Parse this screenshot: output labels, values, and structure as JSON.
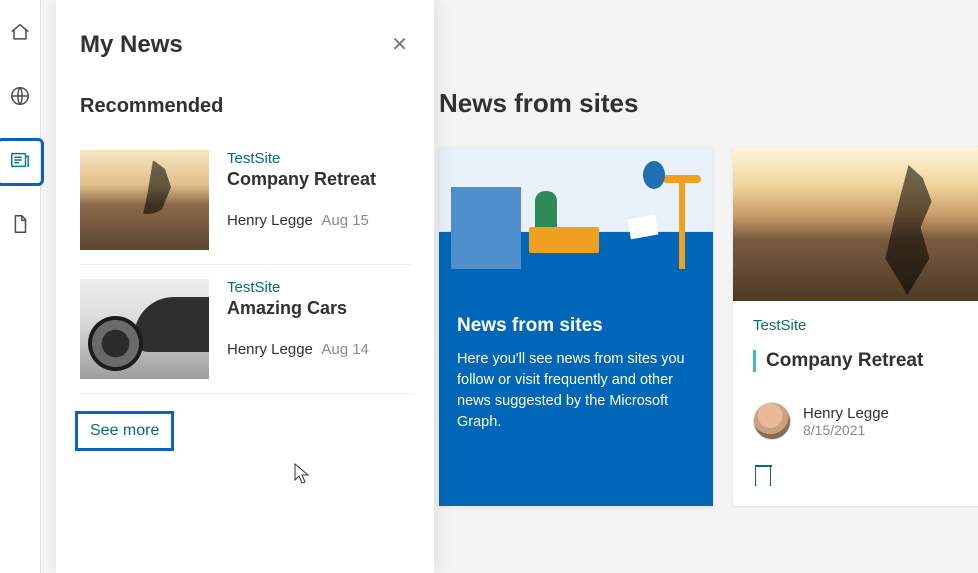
{
  "rail": {
    "items": [
      {
        "name": "home-icon"
      },
      {
        "name": "globe-icon"
      },
      {
        "name": "news-icon"
      },
      {
        "name": "document-icon"
      }
    ]
  },
  "flyout": {
    "title": "My News",
    "section_title": "Recommended",
    "items": [
      {
        "site": "TestSite",
        "title": "Company Retreat",
        "author": "Henry Legge",
        "date": "Aug 15"
      },
      {
        "site": "TestSite",
        "title": "Amazing Cars",
        "author": "Henry Legge",
        "date": "Aug 14"
      }
    ],
    "see_more": "See more"
  },
  "main": {
    "heading": "News from sites",
    "info_card": {
      "title": "News from sites",
      "desc": "Here you'll see news from sites you follow or visit frequently and other news suggested by the Microsoft Graph."
    },
    "site_card": {
      "site": "TestSite",
      "title": "Company Retreat",
      "author": "Henry Legge",
      "date": "8/15/2021"
    }
  }
}
